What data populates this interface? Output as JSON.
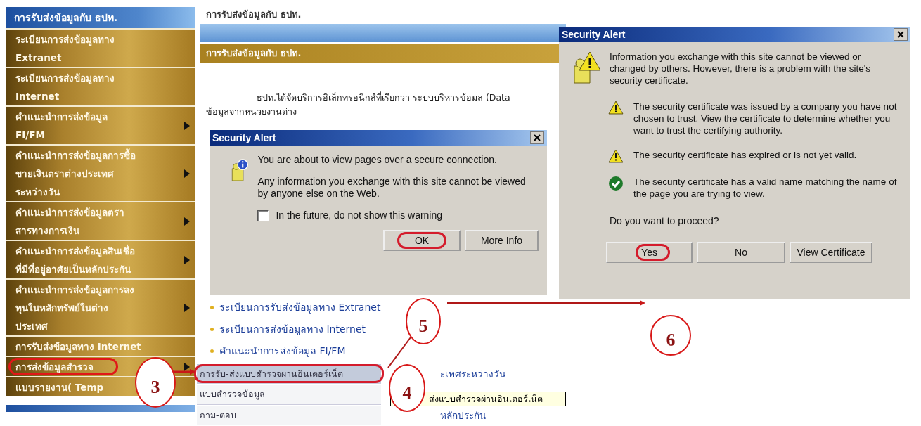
{
  "sidebar": {
    "header": "การรับส่งข้อมูลกับ ธปท.",
    "items": [
      {
        "lines": [
          "ระเบียนการส่งข้อมูลทาง",
          "Extranet"
        ],
        "has_submenu": false,
        "selected": false
      },
      {
        "lines": [
          "ระเบียนการส่งข้อมูลทาง",
          "Internet"
        ],
        "has_submenu": false,
        "selected": false
      },
      {
        "lines": [
          "คำแนะนำการส่งข้อมูล",
          "FI/FM"
        ],
        "has_submenu": true,
        "selected": false
      },
      {
        "lines": [
          "คำแนะนำการส่งข้อมูลการซื้อ",
          "ขายเงินตราต่างประเทศ",
          "ระหว่างวัน"
        ],
        "has_submenu": true,
        "selected": false
      },
      {
        "lines": [
          "คำแนะนำการส่งข้อมูลตรา",
          "สารทางการเงิน"
        ],
        "has_submenu": true,
        "selected": false
      },
      {
        "lines": [
          "คำแนะนำการส่งข้อมูลสินเชื่อ",
          "ที่มีที่อยู่อาศัยเป็นหลักประกัน"
        ],
        "has_submenu": true,
        "selected": false
      },
      {
        "lines": [
          "คำแนะนำการส่งข้อมูลการลง",
          "ทุนในหลักทรัพย์ในต่าง",
          "ประเทศ"
        ],
        "has_submenu": true,
        "selected": false
      },
      {
        "lines": [
          "การรับส่งข้อมูลทาง Internet"
        ],
        "has_submenu": false,
        "selected": false
      },
      {
        "lines": [
          "การส่งข้อมูลสำรวจ"
        ],
        "has_submenu": true,
        "selected": true
      },
      {
        "lines": [
          "แบบรายงาน( Temp"
        ],
        "has_submenu": false,
        "selected": false
      }
    ]
  },
  "page": {
    "breadcrumb": "การรับส่งข้อมูลกับ ธปท.",
    "banner": "การรับส่งข้อมูลกับ ธปท.",
    "paragraph_lines": [
      "ธปท.ได้จัดบริการอิเล็กทรอนิกส์ที่เรียกว่า ระบบบริหารข้อมล (Data",
      "ข้อมูลจากหน่วยงานต่าง"
    ],
    "links": [
      "ระเบียนการรับส่งข้อมูลทาง Extranet",
      "ระเบียนการส่งข้อมูลทาง Internet",
      "คำแนะนำการส่งข้อมูล FI/FM"
    ],
    "submenu": [
      {
        "label": "การรับ-ส่งแบบสำรวจผ่านอินเตอร์เน็ต",
        "side_text": "ะเทศระหว่างวัน",
        "selected": true
      },
      {
        "label": "แบบสำรวจข้อมูล",
        "selected": false
      },
      {
        "label": "ถาม-ตอบ",
        "side_text": "หลักประกัน",
        "selected": false
      }
    ],
    "tooltip": "ส่งแบบสำรวจผ่านอินเตอร์เน็ต"
  },
  "dialogs": [
    {
      "title": "Security Alert",
      "paragraphs": [
        "You are about to view pages over a secure connection.",
        "Any information you exchange with this site cannot be viewed by anyone else on the Web."
      ],
      "checkbox": {
        "label": "In the future, do not show this warning",
        "checked": false
      },
      "buttons": [
        {
          "label": "OK",
          "circled": true
        },
        {
          "label": "More Info",
          "circled": false
        }
      ]
    },
    {
      "title": "Security Alert",
      "paragraphs": [
        "Information you exchange with this site cannot be viewed or changed by others. However, there is a problem with the site's security certificate."
      ],
      "items": [
        {
          "kind": "warning",
          "text": "The security certificate was issued by a company you have not chosen to trust. View the certificate to determine whether you want to trust the certifying authority."
        },
        {
          "kind": "warning",
          "text": "The security certificate has expired or is not yet valid."
        },
        {
          "kind": "ok",
          "text": "The security certificate has a valid name matching the name of the page you are trying to view."
        }
      ],
      "question": "Do you want to proceed?",
      "buttons": [
        {
          "label": "Yes",
          "circled": true
        },
        {
          "label": "No",
          "circled": false
        },
        {
          "label": "View Certificate",
          "circled": false
        }
      ]
    }
  ],
  "callouts": [
    "3",
    "4",
    "5",
    "6"
  ]
}
